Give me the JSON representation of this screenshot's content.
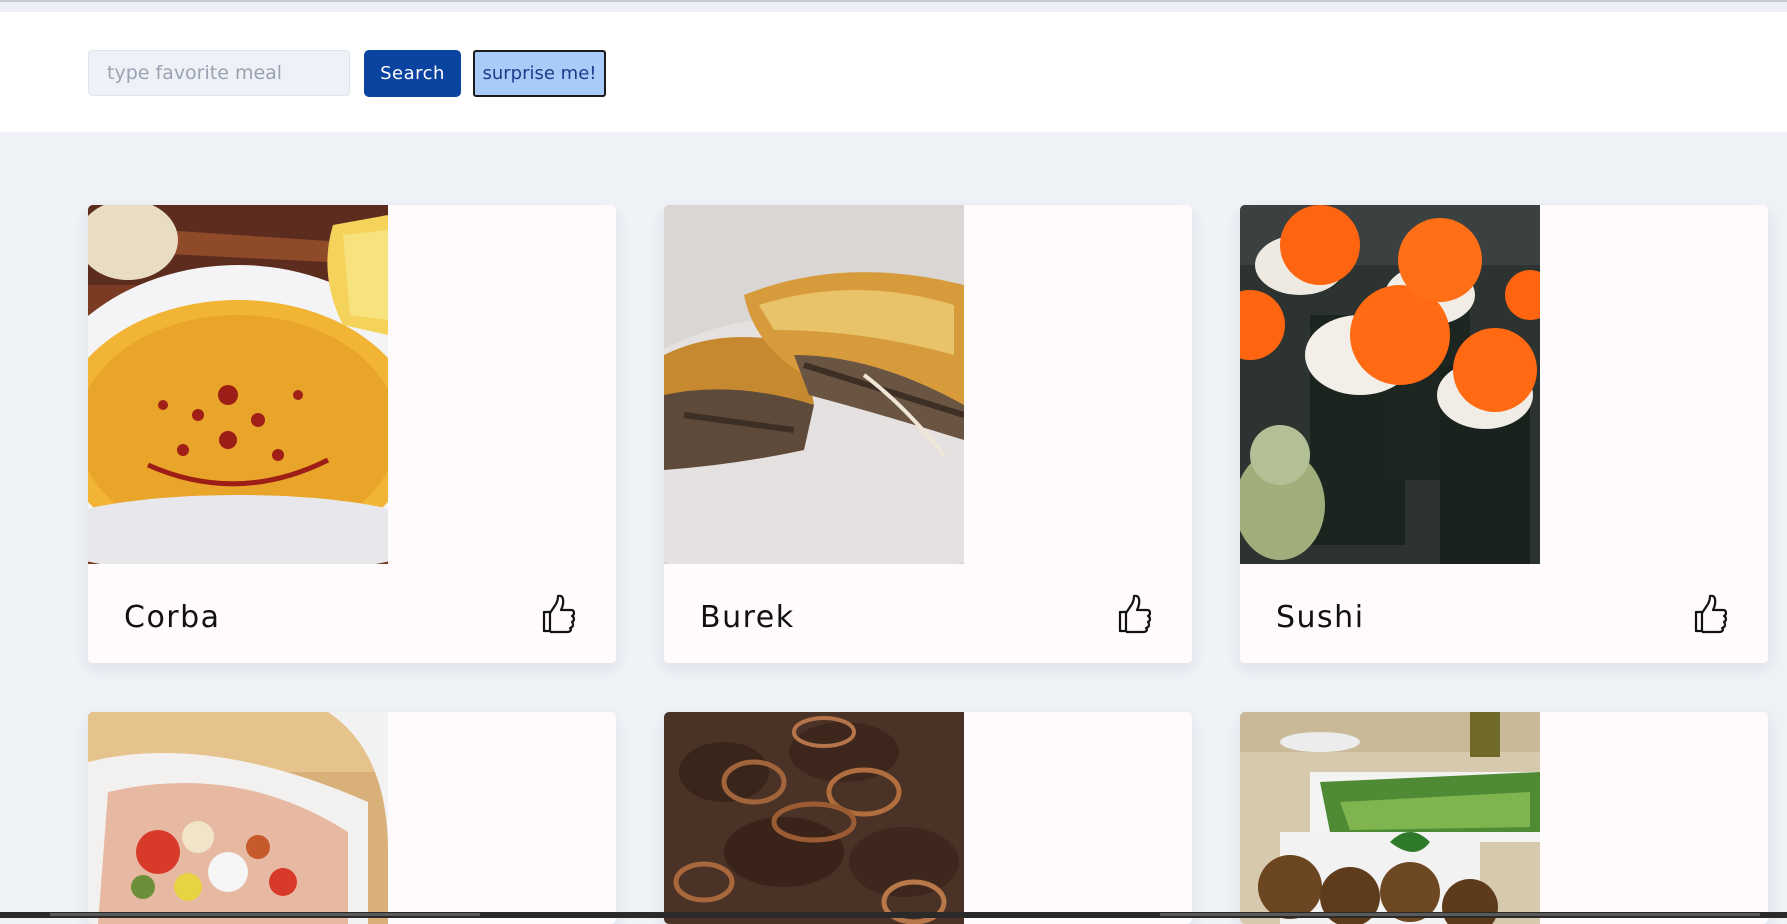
{
  "search": {
    "placeholder": "type favorite meal",
    "value": "",
    "search_label": "Search",
    "surprise_label": "surprise me!"
  },
  "meals": [
    {
      "name": "Corba",
      "image": "lentil-soup-photo",
      "liked": false
    },
    {
      "name": "Burek",
      "image": "meat-pastry-photo",
      "liked": false
    },
    {
      "name": "Sushi",
      "image": "sushi-rolls-photo",
      "liked": false
    }
  ],
  "meals_partial": [
    {
      "image": "stuffed-flatbread-photo"
    },
    {
      "image": "liver-with-onions-photo"
    },
    {
      "image": "falafel-plate-photo"
    }
  ],
  "icons": {
    "like": "thumbs-up-icon"
  },
  "colors": {
    "primary": "#0b43a0",
    "accent_light": "#a9cbf8",
    "page_background": "#eff2f7",
    "card_background": "#fffbfd"
  }
}
